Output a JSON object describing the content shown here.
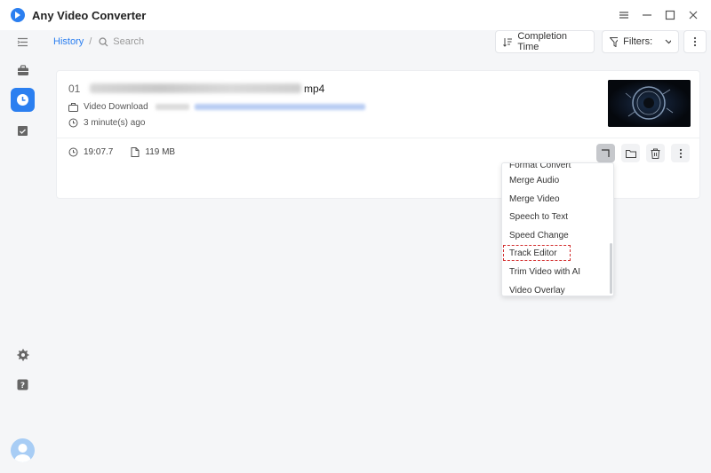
{
  "app": {
    "title": "Any Video Converter"
  },
  "breadcrumb": {
    "history": "History",
    "separator": "/"
  },
  "search": {
    "placeholder": "Search"
  },
  "toolbar": {
    "sort_label": "Completion Time",
    "filters_label": "Filters:"
  },
  "card": {
    "index": "01",
    "extension": "mp4",
    "source_label": "Video Download",
    "time_ago": "3 minute(s) ago",
    "duration": "19:07.7",
    "size": "119 MB"
  },
  "menu": {
    "items": [
      {
        "label": "Format Convert"
      },
      {
        "label": "Merge Audio"
      },
      {
        "label": "Merge Video"
      },
      {
        "label": "Speech to Text"
      },
      {
        "label": "Speed Change"
      },
      {
        "label": "Track Editor"
      },
      {
        "label": "Trim Video with AI"
      },
      {
        "label": "Video Overlay"
      }
    ]
  },
  "colors": {
    "accent": "#2b7ff0",
    "highlight_outline": "#d32f2f",
    "background": "#f5f6f8"
  }
}
